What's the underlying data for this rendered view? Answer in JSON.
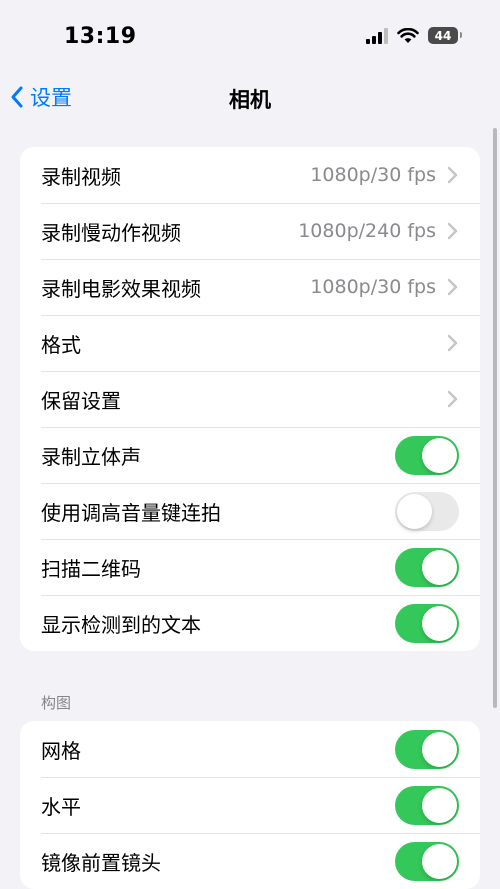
{
  "status_bar": {
    "time": "13:19",
    "battery": "44"
  },
  "nav": {
    "back_label": "设置",
    "title": "相机"
  },
  "group1": [
    {
      "label": "录制视频",
      "value": "1080p/30 fps",
      "type": "link"
    },
    {
      "label": "录制慢动作视频",
      "value": "1080p/240 fps",
      "type": "link"
    },
    {
      "label": "录制电影效果视频",
      "value": "1080p/30 fps",
      "type": "link"
    },
    {
      "label": "格式",
      "value": "",
      "type": "link"
    },
    {
      "label": "保留设置",
      "value": "",
      "type": "link"
    },
    {
      "label": "录制立体声",
      "type": "toggle",
      "on": true
    },
    {
      "label": "使用调高音量键连拍",
      "type": "toggle",
      "on": false
    },
    {
      "label": "扫描二维码",
      "type": "toggle",
      "on": true
    },
    {
      "label": "显示检测到的文本",
      "type": "toggle",
      "on": true
    }
  ],
  "section2_header": "构图",
  "group2": [
    {
      "label": "网格",
      "type": "toggle",
      "on": true
    },
    {
      "label": "水平",
      "type": "toggle",
      "on": true
    },
    {
      "label": "镜像前置镜头",
      "type": "toggle",
      "on": true
    }
  ],
  "colors": {
    "accent": "#007aff",
    "toggle_on": "#34c759",
    "toggle_off": "#e9e9ea",
    "background": "#f2f2f7"
  }
}
